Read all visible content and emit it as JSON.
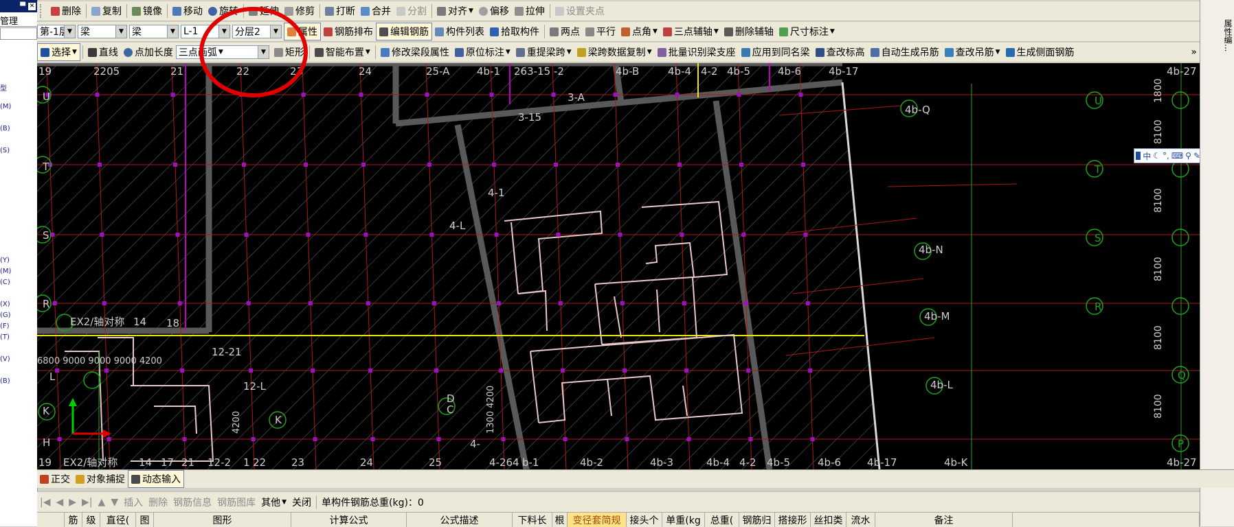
{
  "left_panel": {
    "pin_icon": "pin-icon",
    "close_icon": "close-icon",
    "title": "管理",
    "item_a": "型",
    "item_b": "(M)",
    "item_c": "(B)",
    "item_d": "(S)",
    "item_e": "(Y)",
    "item_f": "(M)",
    "item_g": "(C)",
    "item_h": "(X)",
    "item_i": "(G)",
    "item_j": "(F)",
    "item_k": "(T)",
    "item_l": "(V)",
    "item_m": "(B)"
  },
  "toolbar1": {
    "delete": "删除",
    "copy": "复制",
    "mirror": "镜像",
    "move": "移动",
    "rotate": "旋转",
    "extend": "延伸",
    "trim": "修剪",
    "break": "打断",
    "merge": "合并",
    "split": "分割",
    "align": "对齐",
    "offset": "偏移",
    "stretch": "拉伸",
    "set_grip": "设置夹点"
  },
  "toolbar2": {
    "floor": "第-1层",
    "type1": "梁",
    "type2": "梁",
    "name": "L-1",
    "layer": "分层2",
    "property": "属性",
    "rebar_layout": "钢筋排布",
    "edit_rebar": "编辑钢筋",
    "component_list": "构件列表",
    "pick_component": "拾取构件",
    "two_points": "两点",
    "parallel": "平行",
    "point_angle": "点角",
    "three_point_axis": "三点辅轴",
    "delete_axis": "删除辅轴",
    "dim": "尺寸标注"
  },
  "toolbar3": {
    "select": "选择",
    "line": "直线",
    "point_length": "点加长度",
    "arc_mode": "三点画弧",
    "rect": "矩形",
    "smart_layout": "智能布置",
    "modify_segment": "修改梁段属性",
    "in_place": "原位标注",
    "re_extract": "重提梁跨",
    "span_copy": "梁跨数据复制",
    "batch_support": "批量识别梁支座",
    "apply_same": "应用到同名梁",
    "change_elev": "查改标高",
    "auto_hanger": "自动生成吊筋",
    "change_hanger": "查改吊筋",
    "side_rebar": "生成侧面钢筋",
    "more": "»"
  },
  "drawing": {
    "top_labels": [
      "19",
      "2205",
      "21",
      "22",
      "23",
      "24",
      "25-A",
      "4b-1",
      "263-15",
      "-2",
      "4b-B",
      "4b-4",
      "4-2",
      "4b-5",
      "4b-6",
      "4b-17",
      "4b-27"
    ],
    "bottom_labels": [
      "19",
      "EX2/轴对称",
      "14",
      "17",
      "21",
      "12-2",
      "1",
      "22",
      "23",
      "24",
      "25",
      "4-264",
      "b-1",
      "4b-2",
      "4b-3",
      "4b-4",
      "4-2",
      "4b-5",
      "4b-6",
      "4b-17",
      "4b-K",
      "4b-27"
    ],
    "left_axes": [
      "U",
      "T",
      "S",
      "R",
      "L",
      "K",
      "H"
    ],
    "right_axes": [
      "U",
      "T",
      "S",
      "R",
      "Q",
      "P"
    ],
    "right_dims": [
      "1800",
      "8100",
      "8100",
      "8100",
      "8100",
      "8100"
    ],
    "callouts": [
      "4b-Q",
      "4b-N",
      "4b-M",
      "4b-L"
    ],
    "labels": {
      "3a": "3-A",
      "315": "3-15",
      "41": "4-1",
      "4l": "4-L",
      "1221": "12-21",
      "12l": "12-L",
      "ex2": "EX2/轴对称",
      "14": "14",
      "18": "18",
      "dims_left": "6800 9000 9000 9000 4200",
      "dc_d": "D",
      "dc_c": "C",
      "vert1": "1300 4200",
      "vert2": "4200",
      "k": "K",
      "4dash": "4-"
    }
  },
  "floating_ime": {
    "cn": "中",
    "icons": [
      "moon-icon",
      "punct-icon",
      "keyboard-icon",
      "user-icon",
      "wrench-icon"
    ]
  },
  "status": {
    "ortho": "正交",
    "snap": "对象捕捉",
    "dyn_input": "动态输入"
  },
  "grid_toolbar": {
    "insert": "插入",
    "delete": "删除",
    "rebar_info": "钢筋信息",
    "rebar_lib": "钢筋图库",
    "other": "其他",
    "close": "关闭",
    "total": "单构件钢筋总重(kg)：0"
  },
  "grid_headers": [
    "筋",
    "级",
    "直径(",
    "图",
    "图形",
    "计算公式",
    "公式描述",
    "下料长",
    "根",
    "变径套简规",
    "接头个",
    "单重(kg",
    "总重(",
    "钢筋归",
    "搭接形",
    "丝扣类",
    "流水",
    "备注"
  ],
  "right_panel": {
    "title": "属性编..."
  },
  "colors": {
    "canvas_bg": "#000000",
    "grid_red": "#b01818",
    "beam_gray": "#595959",
    "accent_magenta": "#c000c0",
    "axis_green": "#1fa31f",
    "yellow_line": "#e8e800",
    "annotation_red": "#e00000",
    "highlight_header": "#ffe28a"
  }
}
